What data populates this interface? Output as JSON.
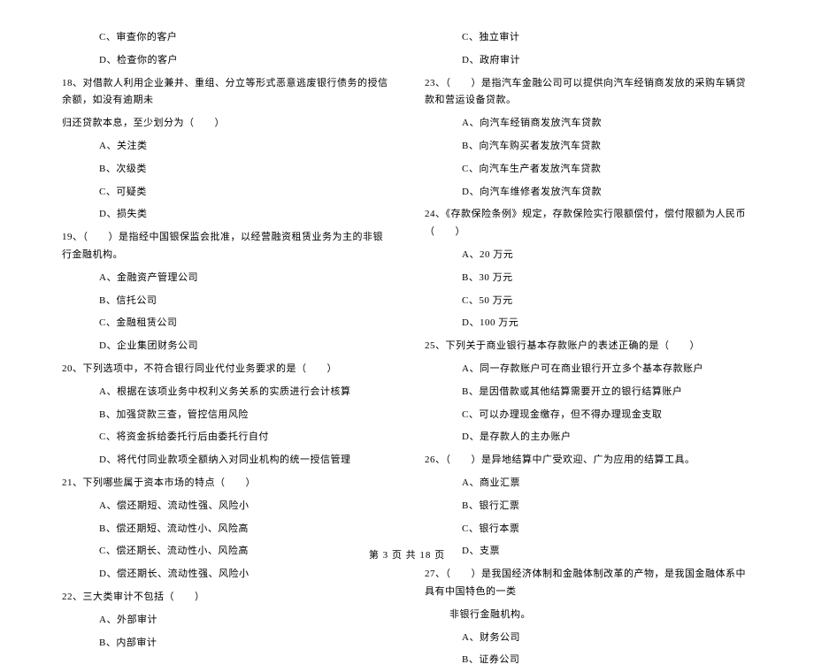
{
  "left_column": [
    {
      "type": "option",
      "text": "C、审查你的客户"
    },
    {
      "type": "option",
      "text": "D、检查你的客户"
    },
    {
      "type": "question",
      "text": "18、对借款人利用企业兼并、重组、分立等形式恶意逃废银行债务的授信余额，如没有逾期未"
    },
    {
      "type": "continuation",
      "text": "归还贷款本息，至少划分为（　　）"
    },
    {
      "type": "option",
      "text": "A、关注类"
    },
    {
      "type": "option",
      "text": "B、次级类"
    },
    {
      "type": "option",
      "text": "C、可疑类"
    },
    {
      "type": "option",
      "text": "D、损失类"
    },
    {
      "type": "question",
      "text": "19、（　　）是指经中国银保监会批准，以经营融资租赁业务为主的非银行金融机构。"
    },
    {
      "type": "option",
      "text": "A、金融资产管理公司"
    },
    {
      "type": "option",
      "text": "B、信托公司"
    },
    {
      "type": "option",
      "text": "C、金融租赁公司"
    },
    {
      "type": "option",
      "text": "D、企业集团财务公司"
    },
    {
      "type": "question",
      "text": "20、下列选项中，不符合银行同业代付业务要求的是（　　）"
    },
    {
      "type": "option",
      "text": "A、根据在该项业务中权利义务关系的实质进行会计核算"
    },
    {
      "type": "option",
      "text": "B、加强贷款三查，管控信用风险"
    },
    {
      "type": "option",
      "text": "C、将资金拆给委托行后由委托行自付"
    },
    {
      "type": "option",
      "text": "D、将代付同业款项全额纳入对同业机构的统一授信管理"
    },
    {
      "type": "question",
      "text": "21、下列哪些属于资本市场的特点（　　）"
    },
    {
      "type": "option",
      "text": "A、偿还期短、流动性强、风险小"
    },
    {
      "type": "option",
      "text": "B、偿还期短、流动性小、风险高"
    },
    {
      "type": "option",
      "text": "C、偿还期长、流动性小、风险高"
    },
    {
      "type": "option",
      "text": "D、偿还期长、流动性强、风险小"
    },
    {
      "type": "question",
      "text": "22、三大类审计不包括（　　）"
    },
    {
      "type": "option",
      "text": "A、外部审计"
    },
    {
      "type": "option",
      "text": "B、内部审计"
    }
  ],
  "right_column": [
    {
      "type": "option",
      "text": "C、独立审计"
    },
    {
      "type": "option",
      "text": "D、政府审计"
    },
    {
      "type": "question",
      "text": "23、（　　）是指汽车金融公司可以提供向汽车经销商发放的采购车辆贷款和营运设备贷款。"
    },
    {
      "type": "option",
      "text": "A、向汽车经销商发放汽车贷款"
    },
    {
      "type": "option",
      "text": "B、向汽车购买者发放汽车贷款"
    },
    {
      "type": "option",
      "text": "C、向汽车生产者发放汽车贷款"
    },
    {
      "type": "option",
      "text": "D、向汽车维修者发放汽车贷款"
    },
    {
      "type": "question",
      "text": "24、《存款保险条例》规定，存款保险实行限额偿付，偿付限额为人民币（　　）"
    },
    {
      "type": "option",
      "text": "A、20 万元"
    },
    {
      "type": "option",
      "text": "B、30 万元"
    },
    {
      "type": "option",
      "text": "C、50 万元"
    },
    {
      "type": "option",
      "text": "D、100 万元"
    },
    {
      "type": "question",
      "text": "25、下列关于商业银行基本存款账户的表述正确的是（　　）"
    },
    {
      "type": "option",
      "text": "A、同一存款账户可在商业银行开立多个基本存款账户"
    },
    {
      "type": "option",
      "text": "B、是因借款或其他结算需要开立的银行结算账户"
    },
    {
      "type": "option",
      "text": "C、可以办理现金缴存，但不得办理现金支取"
    },
    {
      "type": "option",
      "text": "D、是存款人的主办账户"
    },
    {
      "type": "question",
      "text": "26、（　　）是异地结算中广受欢迎、广为应用的结算工具。"
    },
    {
      "type": "option",
      "text": "A、商业汇票"
    },
    {
      "type": "option",
      "text": "B、银行汇票"
    },
    {
      "type": "option",
      "text": "C、银行本票"
    },
    {
      "type": "option",
      "text": "D、支票"
    },
    {
      "type": "question",
      "text": "27、（　　）是我国经济体制和金融体制改革的产物，是我国金融体系中具有中国特色的一类"
    },
    {
      "type": "sub-continuation",
      "text": "非银行金融机构。"
    },
    {
      "type": "option",
      "text": "A、财务公司"
    },
    {
      "type": "option",
      "text": "B、证券公司"
    }
  ],
  "footer": "第 3 页 共 18 页"
}
